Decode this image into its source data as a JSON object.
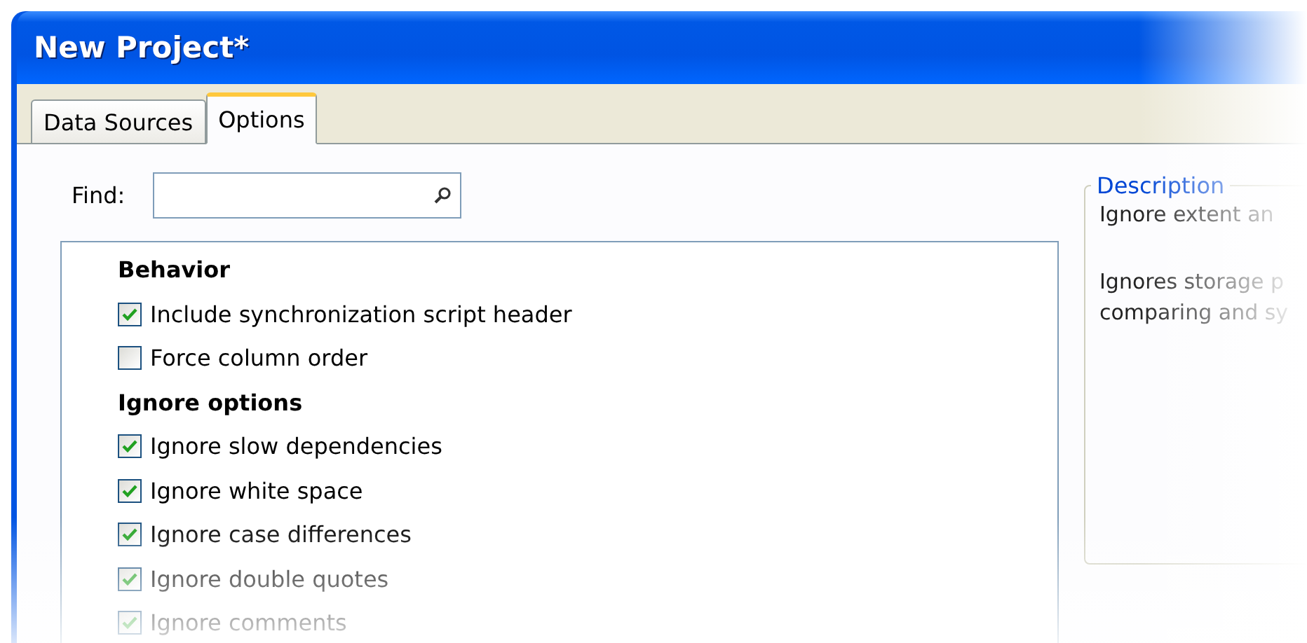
{
  "window": {
    "title": "New Project*"
  },
  "tabs": [
    {
      "label": "Data Sources",
      "selected": false
    },
    {
      "label": "Options",
      "selected": true
    }
  ],
  "find": {
    "label": "Find:"
  },
  "options": [
    {
      "kind": "heading",
      "label": "Behavior"
    },
    {
      "kind": "checkbox",
      "label": "Include synchronization script header",
      "checked": true
    },
    {
      "kind": "checkbox",
      "label": "Force column order",
      "checked": false
    },
    {
      "kind": "heading",
      "label": "Ignore options"
    },
    {
      "kind": "checkbox",
      "label": "Ignore slow dependencies",
      "checked": true
    },
    {
      "kind": "checkbox",
      "label": "Ignore white space",
      "checked": true
    },
    {
      "kind": "checkbox",
      "label": "Ignore case differences",
      "checked": true
    },
    {
      "kind": "checkbox",
      "label": "Ignore double quotes",
      "checked": true
    },
    {
      "kind": "checkbox",
      "label": "Ignore comments",
      "checked": true
    }
  ],
  "description": {
    "title": "Description",
    "paragraphs": [
      "Ignore extent an",
      "Ignores storage p\ncomparing and sy"
    ]
  }
}
